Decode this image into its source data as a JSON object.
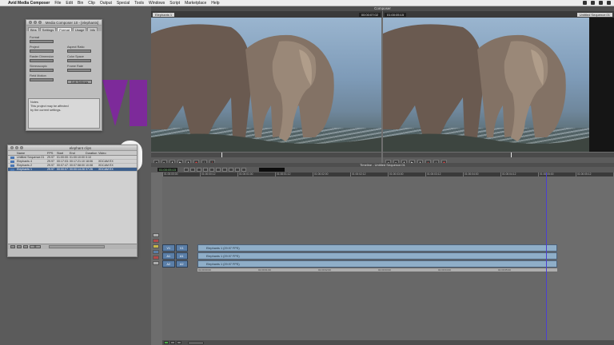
{
  "menubar": {
    "app": "Avid Media Composer",
    "items": [
      "File",
      "Edit",
      "Bin",
      "Clip",
      "Output",
      "Special",
      "Tools",
      "Windows",
      "Script",
      "Marketplace",
      "Help"
    ]
  },
  "media_composer_panel": {
    "title": "Media Composer 10 - [elephants]",
    "tabs": [
      "Bins",
      "Settings",
      "Format",
      "Usage",
      "Info"
    ],
    "fields": [
      "Format",
      "Project",
      "Aspect Ratio",
      "Raster Dimension",
      "Color Space",
      "Stereoscopic",
      "Frame Rate",
      "Field Motion"
    ],
    "button": "Edit Settings",
    "info_lines": [
      "Notes",
      "This project may be affected",
      "by the current settings."
    ]
  },
  "bin": {
    "title": "elephant clips",
    "columns": [
      "",
      "Name",
      "FPS",
      "Start",
      "End",
      "Duration",
      "Video"
    ],
    "rows": [
      {
        "name": "Untitled Sequence.01",
        "fps": "29.97",
        "start": "01:00:00:00",
        "end": "01:00:10:00",
        "duration": "0:10",
        "video": "",
        "selected": false
      },
      {
        "name": "Elephants 4",
        "fps": "29.97",
        "start": "00:17:03:04",
        "end": "00:17:21:10",
        "duration": "18:06",
        "video": "XDCAM EX",
        "selected": false
      },
      {
        "name": "Elephants 2",
        "fps": "29.97",
        "start": "00:07:47:22",
        "end": "00:07:58:00",
        "duration": "10:08",
        "video": "XDCAM EX",
        "selected": false
      },
      {
        "name": "Elephants 1",
        "fps": "29.97",
        "start": "00:00:07:02",
        "end": "00:00:14:28",
        "duration": "07:26",
        "video": "XDCAM EX",
        "selected": true
      }
    ]
  },
  "composer": {
    "title": "Composer",
    "source_name": "Elephants 1",
    "source_tc": "00:00:07:02",
    "record_name": "Untitled Sequence.01",
    "record_tc": "01:00:05:15"
  },
  "timeline": {
    "title": "Timeline - Untitled Sequence.01",
    "tc": "01:00:05:15",
    "ruler": [
      "01:00:00:00",
      "01:00:00:12",
      "01:00:01:00",
      "01:00:01:12",
      "01:00:02:00",
      "01:00:02:12",
      "01:00:03:00",
      "01:00:03:12",
      "01:00:04:00",
      "01:00:04:12",
      "01:00:05:00",
      "01:00:05:12"
    ],
    "tracks": [
      {
        "head": [
          "V1",
          "V1"
        ],
        "clip": "Elephants 1 (29.97 FPS)"
      },
      {
        "head": [
          "A1",
          "A1"
        ],
        "clip": "Elephants 1 (29.97 FPS)"
      },
      {
        "head": [
          "A2",
          "A2"
        ],
        "clip": "Elephants 1 (29.97 FPS)"
      }
    ],
    "tc_track": [
      "01:00:00:00",
      "01:00:01:00",
      "01:00:02:00",
      "01:00:03:00",
      "01:00:04:00",
      "01:00:05:00"
    ]
  }
}
